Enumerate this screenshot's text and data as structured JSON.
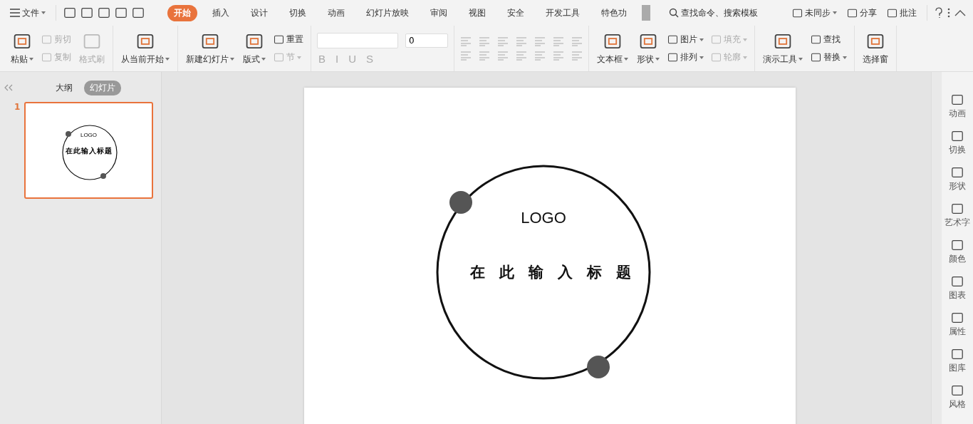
{
  "menu": {
    "label": "文件"
  },
  "tabs": [
    {
      "label": "开始",
      "selected": true
    },
    {
      "label": "插入",
      "selected": false
    },
    {
      "label": "设计",
      "selected": false
    },
    {
      "label": "切换",
      "selected": false
    },
    {
      "label": "动画",
      "selected": false
    },
    {
      "label": "幻灯片放映",
      "selected": false
    },
    {
      "label": "审阅",
      "selected": false
    },
    {
      "label": "视图",
      "selected": false
    },
    {
      "label": "安全",
      "selected": false
    },
    {
      "label": "开发工具",
      "selected": false
    },
    {
      "label": "特色功",
      "selected": false
    }
  ],
  "search": {
    "placeholder": "查找命令、搜索模板"
  },
  "top_actions": [
    {
      "label": "未同步",
      "dropdown": true
    },
    {
      "label": "分享",
      "dropdown": false
    },
    {
      "label": "批注",
      "dropdown": false
    }
  ],
  "ribbon": [
    {
      "kind": "buttons",
      "items": [
        {
          "kind": "large",
          "label": "粘贴",
          "disabled": false,
          "dropdown": true
        },
        {
          "kind": "stack",
          "items": [
            {
              "label": "剪切",
              "disabled": true,
              "dropdown": false
            },
            {
              "label": "复制",
              "disabled": true,
              "dropdown": false
            }
          ]
        },
        {
          "kind": "large",
          "label": "格式刷",
          "disabled": true,
          "dropdown": false
        }
      ]
    },
    {
      "kind": "buttons",
      "items": [
        {
          "kind": "large",
          "label": "从当前开始",
          "disabled": false,
          "dropdown": true
        }
      ]
    },
    {
      "kind": "buttons",
      "items": [
        {
          "kind": "large",
          "label": "新建幻灯片",
          "disabled": false,
          "dropdown": true
        },
        {
          "kind": "large",
          "label": "版式",
          "disabled": false,
          "dropdown": true
        },
        {
          "kind": "stack",
          "items": [
            {
              "label": "重置",
              "disabled": false,
              "dropdown": false
            },
            {
              "label": "节",
              "disabled": true,
              "dropdown": true
            }
          ]
        }
      ]
    },
    {
      "kind": "font",
      "font_size": "0",
      "styles": [
        {
          "label": "B",
          "disabled": true
        },
        {
          "label": "I",
          "disabled": true
        },
        {
          "label": "U",
          "disabled": true
        },
        {
          "label": "S",
          "disabled": true
        }
      ]
    },
    {
      "kind": "paragraph"
    },
    {
      "kind": "buttons",
      "items": [
        {
          "kind": "large",
          "label": "文本框",
          "disabled": false,
          "dropdown": true
        },
        {
          "kind": "large",
          "label": "形状",
          "disabled": false,
          "dropdown": true
        },
        {
          "kind": "stack",
          "items": [
            {
              "label": "图片",
              "disabled": false,
              "dropdown": true
            },
            {
              "label": "排列",
              "disabled": false,
              "dropdown": true
            }
          ]
        },
        {
          "kind": "stack",
          "items": [
            {
              "label": "填充",
              "disabled": true,
              "dropdown": true
            },
            {
              "label": "轮廓",
              "disabled": true,
              "dropdown": true
            }
          ]
        }
      ]
    },
    {
      "kind": "buttons",
      "items": [
        {
          "kind": "large",
          "label": "演示工具",
          "disabled": false,
          "dropdown": true
        },
        {
          "kind": "stack",
          "items": [
            {
              "label": "查找",
              "disabled": false,
              "dropdown": false
            },
            {
              "label": "替换",
              "disabled": false,
              "dropdown": true
            }
          ]
        }
      ]
    },
    {
      "kind": "buttons",
      "items": [
        {
          "kind": "large",
          "label": "选择窗",
          "disabled": false,
          "dropdown": false
        }
      ]
    }
  ],
  "left_panel": {
    "tabs": [
      {
        "label": "大纲",
        "selected": false
      },
      {
        "label": "幻灯片",
        "selected": true
      }
    ],
    "thumbnails": [
      {
        "number": "1",
        "selected": true,
        "logo": "LOGO",
        "title": "在此输入标题"
      }
    ]
  },
  "slide": {
    "logo": "LOGO",
    "title": "在此输入标题"
  },
  "right_panel": [
    {
      "label": "动画"
    },
    {
      "label": "切换"
    },
    {
      "label": "形状"
    },
    {
      "label": "艺术字"
    },
    {
      "label": "颜色"
    },
    {
      "label": "图表"
    },
    {
      "label": "属性"
    },
    {
      "label": "图库"
    },
    {
      "label": "风格"
    }
  ]
}
